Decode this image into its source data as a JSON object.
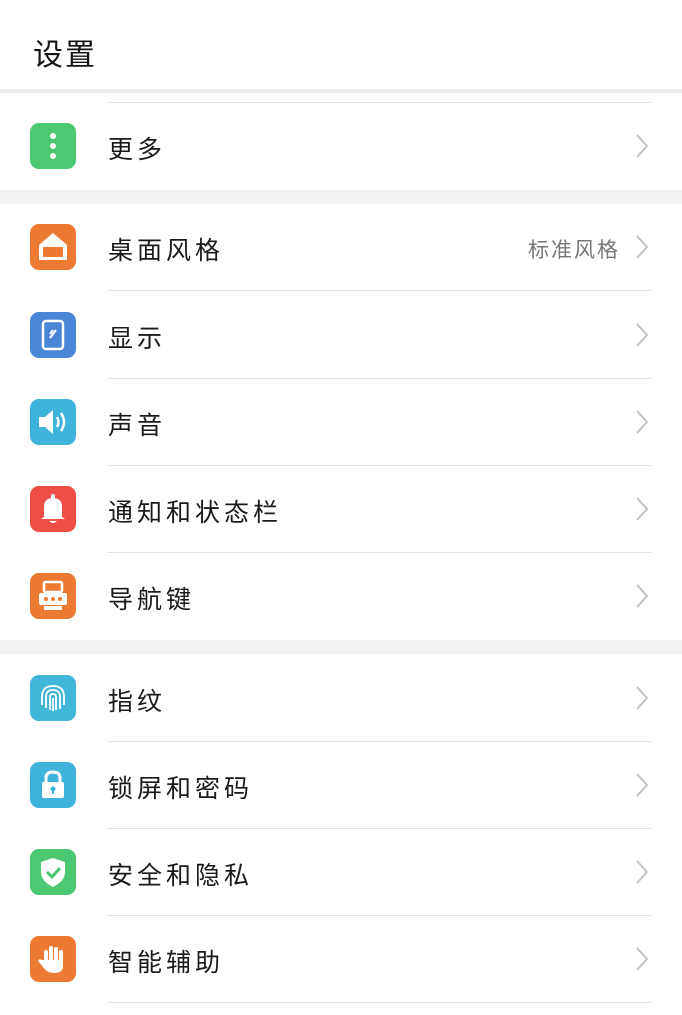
{
  "header": {
    "title": "设置"
  },
  "colors": {
    "more": "#4cc772",
    "home": "#ec7a32",
    "display": "#4a86d6",
    "sound": "#3fb3dc",
    "notify": "#ef4e47",
    "nav": "#ec7a32",
    "fingerprint": "#42b6d9",
    "lock": "#3fb3dc",
    "security": "#4cc772",
    "assist": "#ec7a32"
  },
  "groups": [
    {
      "items": [
        {
          "label": "更多",
          "icon": "more-dots-icon"
        }
      ]
    },
    {
      "items": [
        {
          "label": "桌面风格",
          "value": "标准风格",
          "icon": "home-icon"
        },
        {
          "label": "显示",
          "icon": "display-icon"
        },
        {
          "label": "声音",
          "icon": "speaker-icon"
        },
        {
          "label": "通知和状态栏",
          "icon": "bell-icon"
        },
        {
          "label": "导航键",
          "icon": "navigation-key-icon"
        }
      ]
    },
    {
      "items": [
        {
          "label": "指纹",
          "icon": "fingerprint-icon"
        },
        {
          "label": "锁屏和密码",
          "icon": "lock-icon"
        },
        {
          "label": "安全和隐私",
          "icon": "shield-check-icon"
        },
        {
          "label": "智能辅助",
          "icon": "hand-icon"
        }
      ]
    }
  ]
}
